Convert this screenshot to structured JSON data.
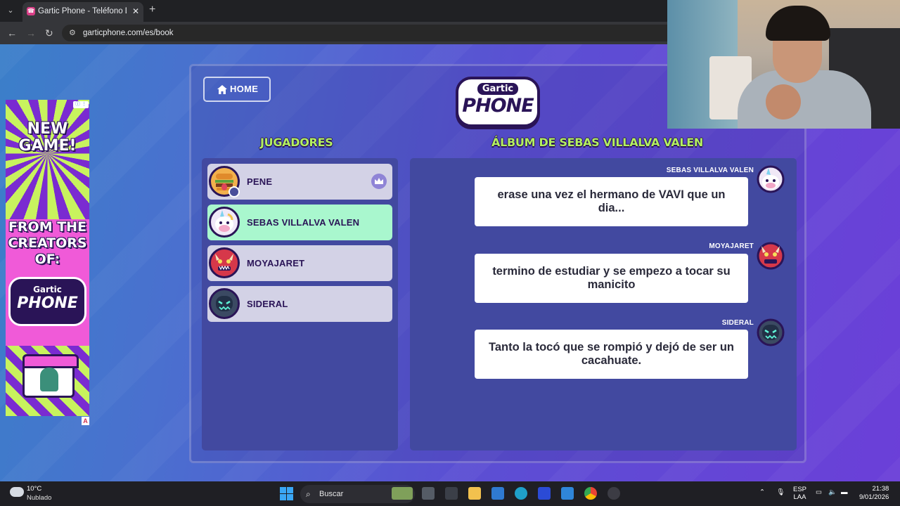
{
  "browser": {
    "tab_title": "Gartic Phone - Teléfono Descon",
    "url": "garticphone.com/es/book"
  },
  "ad": {
    "headline": "NEW GAME!",
    "subline": "FROM THE CREATORS OF:",
    "logo_top": "Gartic",
    "logo_bottom": "PHONE",
    "badge": "A"
  },
  "game": {
    "home_label": "HOME",
    "logo_top": "Gartic",
    "logo_bottom": "PHONE",
    "players_heading": "JUGADORES",
    "album_heading": "ÁLBUM DE SEBAS VILLALVA VALEN",
    "players": [
      {
        "name": "PENE",
        "avatar": "burger-avatar-icon",
        "host": true,
        "active": false
      },
      {
        "name": "SEBAS VILLALVA VALEN",
        "avatar": "unicorn-avatar-icon",
        "host": false,
        "active": true
      },
      {
        "name": "MOYAJARET",
        "avatar": "red-monster-avatar-icon",
        "host": false,
        "active": false
      },
      {
        "name": "SIDERAL",
        "avatar": "dark-robot-avatar-icon",
        "host": false,
        "active": false
      }
    ],
    "album": [
      {
        "author": "SEBAS VILLALVA VALEN",
        "text": "erase una vez el hermano de VAVI que un dia..."
      },
      {
        "author": "MOYAJARET",
        "text": "termino de estudiar y se empezo a tocar su manicito"
      },
      {
        "author": "SIDERAL",
        "text": "Tanto la tocó que se rompió y dejó de ser un cacahuate."
      }
    ]
  },
  "taskbar": {
    "temp": "10°C",
    "weather": "Nublado",
    "search_placeholder": "Buscar",
    "lang_top": "ESP",
    "lang_bottom": "LAA",
    "time": "21:38",
    "date": "9/01/2026"
  },
  "colors": {
    "accent_green": "#b3f060",
    "active_player": "#a9f7ce",
    "panel": "#4249a0",
    "dark_purple": "#2a1457"
  }
}
